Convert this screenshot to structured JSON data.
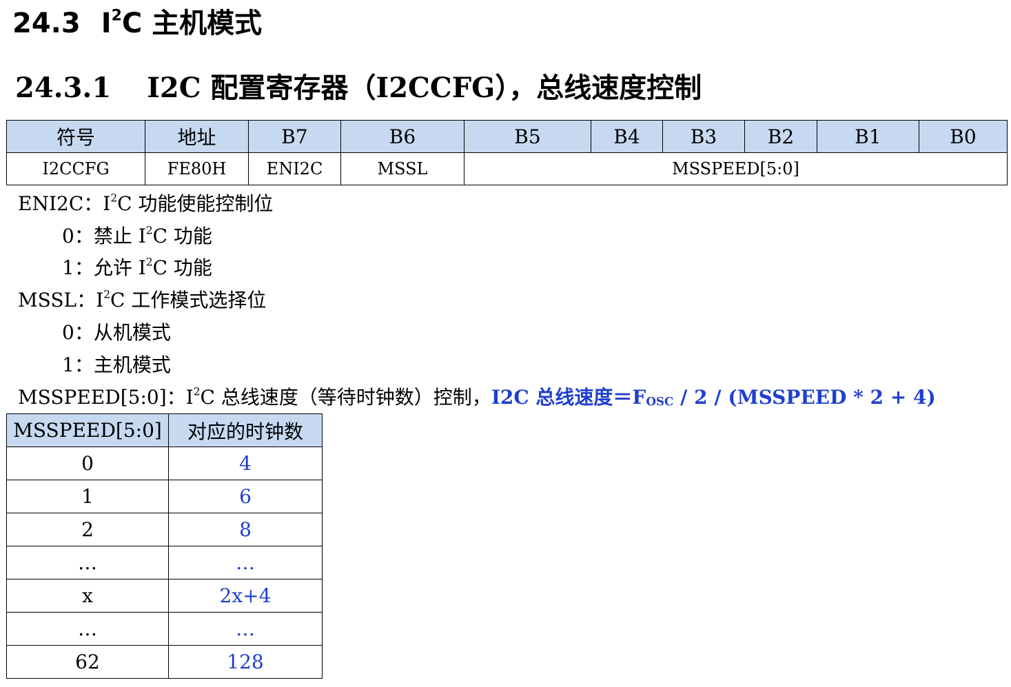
{
  "heading1": {
    "number": "24.3",
    "pre": "I",
    "sup": "2",
    "post": "C 主机模式"
  },
  "heading2": {
    "number": "24.3.1",
    "text": "I2C 配置寄存器（I2CCFG），总线速度控制"
  },
  "register_table": {
    "headers": [
      "符号",
      "地址",
      "B7",
      "B6",
      "B5",
      "B4",
      "B3",
      "B2",
      "B1",
      "B0"
    ],
    "row": {
      "symbol": "I2CCFG",
      "address": "FE80H",
      "b7": "ENI2C",
      "b6": "MSSL",
      "b5_b0": "MSSPEED[5:0]"
    }
  },
  "descriptions": {
    "eni2c": {
      "label": "ENI2C：",
      "pre": "I",
      "sup": "2",
      "post": "C 功能使能控制位",
      "options": [
        {
          "pre": "0：禁止 I",
          "sup": "2",
          "post": "C 功能"
        },
        {
          "pre": "1：允许 I",
          "sup": "2",
          "post": "C 功能"
        }
      ]
    },
    "mssl": {
      "label": "MSSL：",
      "pre": "I",
      "sup": "2",
      "post": "C 工作模式选择位",
      "options": [
        "0：从机模式",
        "1：主机模式"
      ]
    },
    "msspeed": {
      "label": "MSSPEED[5:0]：",
      "pre": "I",
      "sup": "2",
      "post": "C 总线速度（等待时钟数）控制，",
      "formula_pre": "I2C 总线速度＝F",
      "formula_sub": "OSC",
      "formula_post": " / 2 / (MSSPEED * 2 + 4)"
    }
  },
  "speed_table": {
    "headers": [
      "MSSPEED[5:0]",
      "对应的时钟数"
    ],
    "rows": [
      {
        "k": "0",
        "v": "4"
      },
      {
        "k": "1",
        "v": "6"
      },
      {
        "k": "2",
        "v": "8"
      },
      {
        "k": "…",
        "v": "…"
      },
      {
        "k": "x",
        "v": "2x+4"
      },
      {
        "k": "…",
        "v": "…"
      },
      {
        "k": "62",
        "v": "128"
      }
    ]
  },
  "colors": {
    "header_bg": "#c6d9f1",
    "accent_blue": "#1f3fcf"
  }
}
